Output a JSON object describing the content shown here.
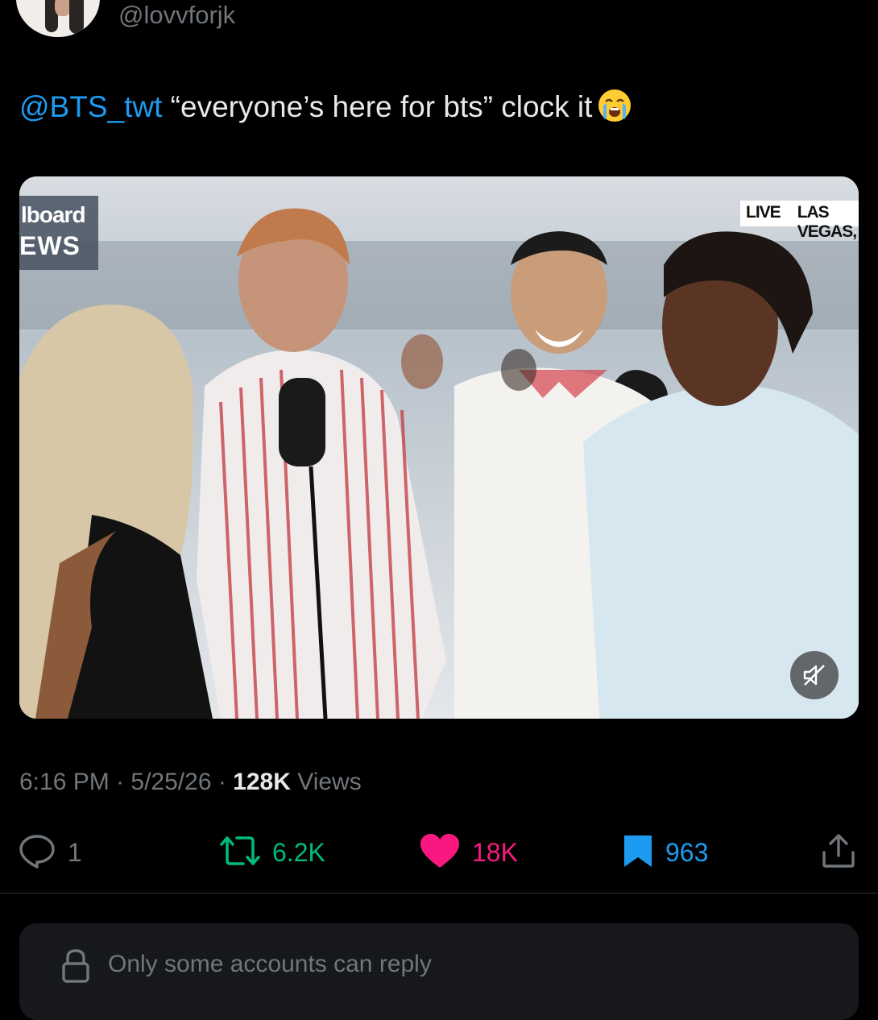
{
  "author": {
    "handle": "@lovvforjk",
    "avatar_icon": "profile-photo"
  },
  "tweet": {
    "mention": "@BTS_twt",
    "text": " “everyone’s here for bts” clock it",
    "emoji_icon": "loudly-crying-face-emoji"
  },
  "media": {
    "logo_line1": "lboard",
    "logo_line2": "EWS",
    "live_label": "LIVE",
    "location_label": "LAS VEGAS,",
    "mute_icon": "muted-speaker-icon"
  },
  "meta": {
    "time": "6:16 PM",
    "separator": " · ",
    "date": "5/25/26",
    "views_count": "128K",
    "views_label": " Views"
  },
  "actions": {
    "reply_count": "1",
    "retweet_count": "6.2K",
    "like_count": "18K",
    "bookmark_count": "963",
    "colors": {
      "reply": "#71767b",
      "retweet": "#00ba7c",
      "like": "#f91880",
      "bookmark": "#1d9bf0"
    }
  },
  "reply_restriction": {
    "text": "Only some accounts can reply",
    "icon": "lock-icon"
  }
}
